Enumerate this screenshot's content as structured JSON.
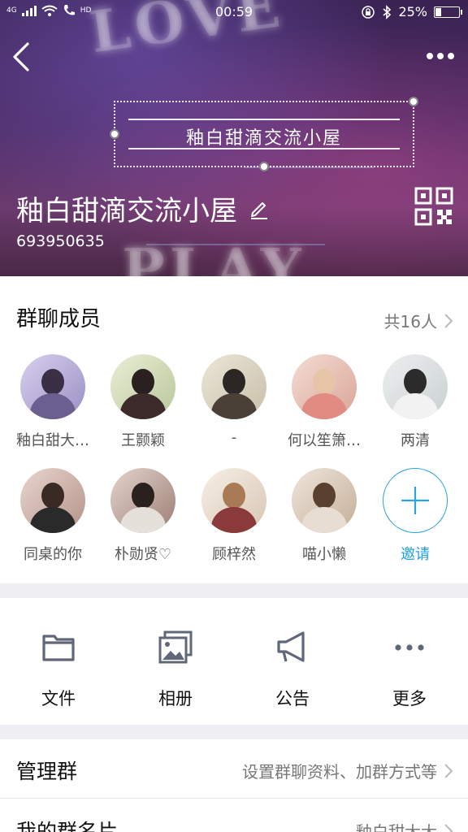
{
  "status_bar": {
    "network": "4G",
    "hd": "HD",
    "time": "00:59",
    "battery": "25%",
    "battery_level": 0.25
  },
  "group": {
    "name": "釉白甜滴交流小屋",
    "id": "693950635",
    "banner_text": "釉白甜滴交流小屋"
  },
  "members_section": {
    "title": "群聊成员",
    "count_label": "共16人",
    "members": [
      {
        "name": "釉白甜大…"
      },
      {
        "name": "王颢颖"
      },
      {
        "name": "-"
      },
      {
        "name": "何以笙箫…"
      },
      {
        "name": "两清"
      },
      {
        "name": "同桌的你"
      },
      {
        "name": "朴勋贤♡"
      },
      {
        "name": "顾梓然"
      },
      {
        "name": "喵小懒"
      }
    ],
    "invite_label": "邀请"
  },
  "actions": [
    {
      "label": "文件",
      "icon": "folder-icon"
    },
    {
      "label": "相册",
      "icon": "photo-album-icon"
    },
    {
      "label": "公告",
      "icon": "megaphone-icon"
    },
    {
      "label": "更多",
      "icon": "more-dots-icon"
    }
  ],
  "settings": {
    "manage_label": "管理群",
    "manage_value": "设置群聊资料、加群方式等",
    "card_label": "我的群名片",
    "card_value": "釉白甜大大"
  },
  "colors": {
    "accent": "#1ea0db",
    "icon_gray": "#5f6778"
  }
}
